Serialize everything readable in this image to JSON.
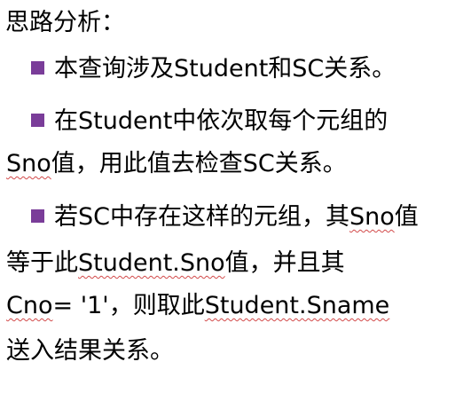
{
  "heading": "思路分析：",
  "bullet_color": "#7a3d99",
  "spell_underline_color": "#d24a4a",
  "points": [
    {
      "line1": "本查询涉及Student和SC关系。"
    },
    {
      "line1": "在Student中依次取每个元组的",
      "line2_sno": "Sno",
      "line2_rest": "值，用此值去检查SC关系。"
    },
    {
      "line1_pre": "若SC中存在这样的元组，其",
      "line1_sno": "Sno",
      "line1_post": "值",
      "line2_pre": "等于此",
      "line2_student": "Student.Sno",
      "line2_post": "值，并且其",
      "line3_cno": "Cno",
      "line3_mid": "= '1'，则取此",
      "line3_sname": "Student.Sname",
      "line4": "送入结果关系。"
    }
  ]
}
